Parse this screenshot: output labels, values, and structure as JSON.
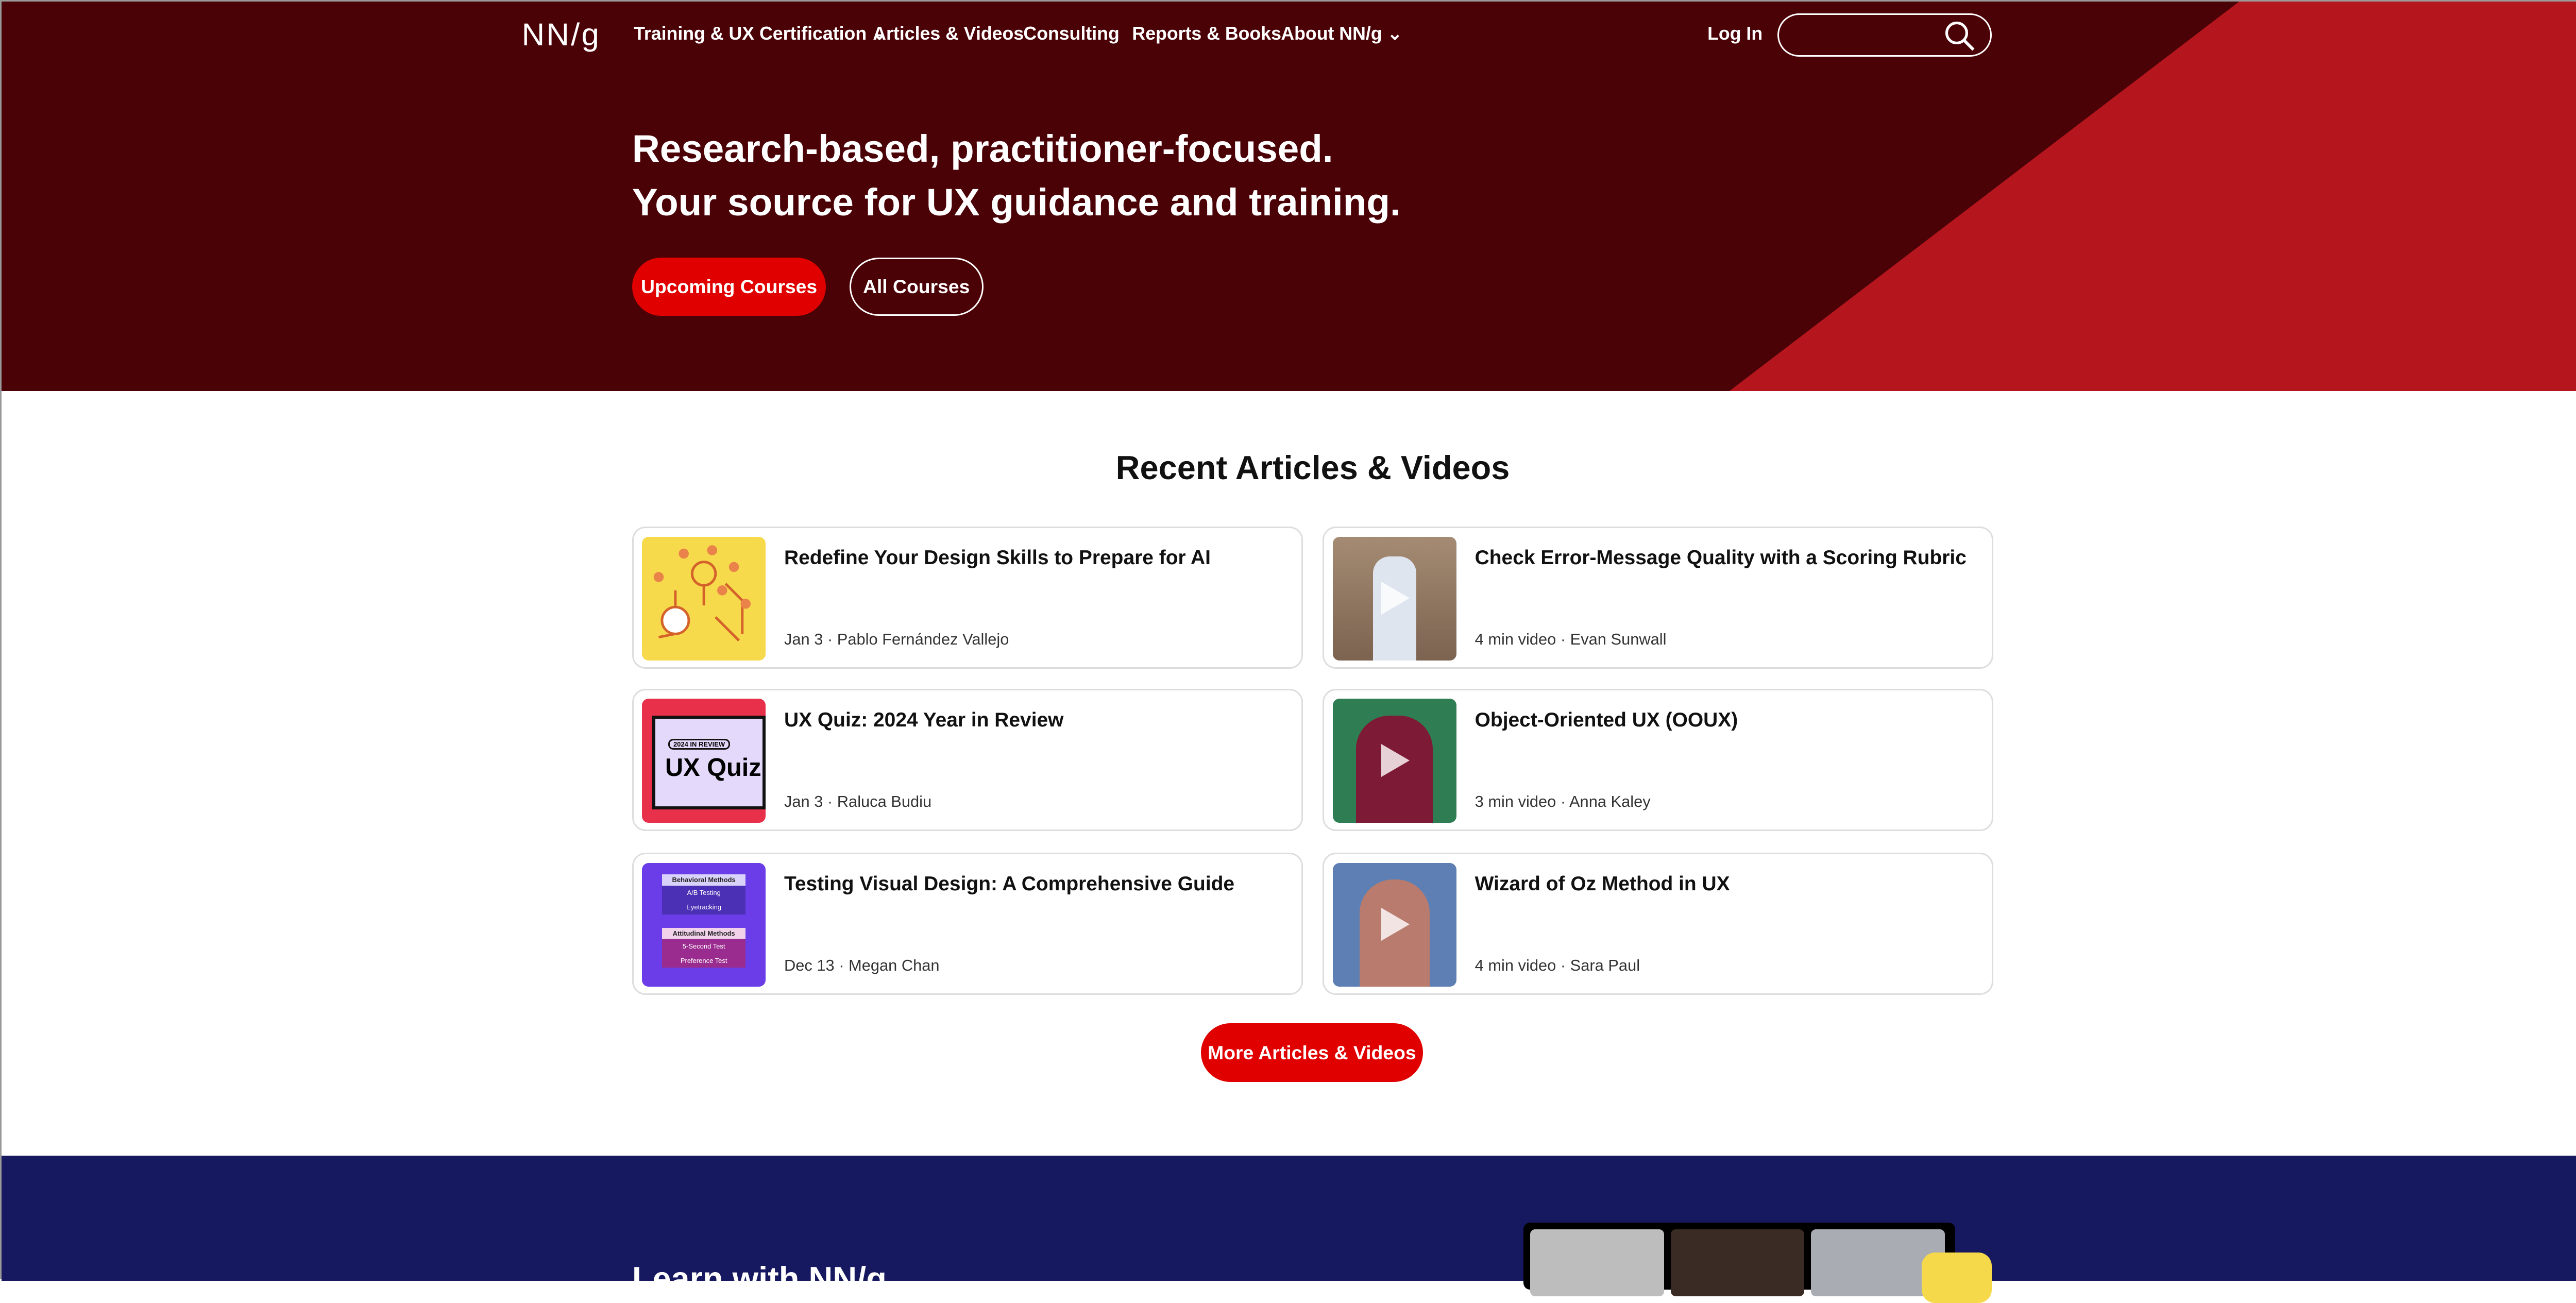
{
  "nav": {
    "logo": "NN/g",
    "items": [
      "Training & UX Certification",
      "Articles & Videos",
      "Consulting",
      "Reports & Books",
      "About NN/g"
    ],
    "login": "Log In",
    "search_placeholder": ""
  },
  "hero": {
    "line1": "Research-based, practitioner-focused.",
    "line2": "Your source for UX guidance and training.",
    "btn_upcoming": "Upcoming Courses",
    "btn_all": "All Courses"
  },
  "recent": {
    "title": "Recent Articles & Videos",
    "more": "More Articles & Videos",
    "cards": [
      {
        "title": "Redefine Your Design Skills to Prepare for AI",
        "meta": "Jan 3 · Pablo Fernández Vallejo"
      },
      {
        "title": "Check Error-Message Quality with a Scoring Rubric",
        "meta": "4 min video · Evan Sunwall"
      },
      {
        "title": "UX Quiz: 2024 Year in Review",
        "meta": "Jan 3 · Raluca Budiu"
      },
      {
        "title": "Object-Oriented UX (OOUX)",
        "meta": "3 min video · Anna Kaley"
      },
      {
        "title": "Testing Visual Design: A Comprehensive Guide",
        "meta": "Dec 13 · Megan Chan"
      },
      {
        "title": "Wizard of Oz Method in UX",
        "meta": "4 min video · Sara Paul"
      }
    ],
    "thumb_text": {
      "quiz_tag": "2024 IN REVIEW",
      "quiz": "UX Quiz",
      "behavioral": "Behavioral Methods",
      "ab": "A/B Testing",
      "eye": "Eyetracking",
      "attitudinal": "Attitudinal Methods",
      "five": "5-Second Test",
      "pref": "Preference Test"
    }
  },
  "learn": {
    "title": "Learn with NN/g"
  },
  "colors": {
    "hero": "#4b0207",
    "accent_red": "#b5161e",
    "button": "#e10000",
    "navy": "#171960"
  }
}
